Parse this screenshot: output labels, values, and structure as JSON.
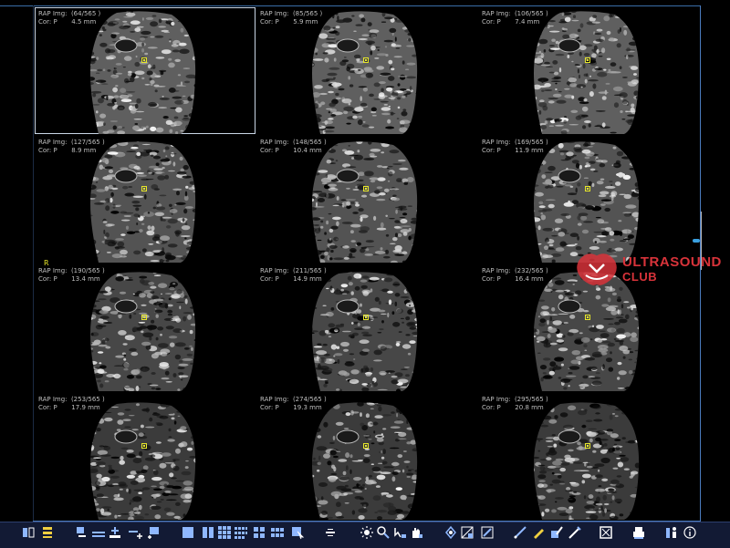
{
  "viewer": {
    "tiles": [
      {
        "title": "RAP Img:  (64/565 )",
        "cor": "Cor: P",
        "depth": "4.5 mm",
        "selected": true
      },
      {
        "title": "RAP Img:  (85/565 )",
        "cor": "Cor: P",
        "depth": "5.9 mm",
        "selected": false
      },
      {
        "title": "RAP Img:  (106/565 )",
        "cor": "Cor: P",
        "depth": "7.4 mm",
        "selected": false
      },
      {
        "title": "RAP Img:  (127/565 )",
        "cor": "Cor: P",
        "depth": "8.9 mm",
        "selected": false
      },
      {
        "title": "RAP Img:  (148/565 )",
        "cor": "Cor: P",
        "depth": "10.4 mm",
        "selected": false
      },
      {
        "title": "RAP Img:  (169/565 )",
        "cor": "Cor: P",
        "depth": "11.9 mm",
        "selected": false
      },
      {
        "title": "RAP Img:  (190/565 )",
        "cor": "Cor: P",
        "depth": "13.4 mm",
        "selected": false
      },
      {
        "title": "RAP Img:  (211/565 )",
        "cor": "Cor: P",
        "depth": "14.9 mm",
        "selected": false
      },
      {
        "title": "RAP Img:  (232/565 )",
        "cor": "Cor: P",
        "depth": "16.4 mm",
        "selected": false
      },
      {
        "title": "RAP Img:  (253/565 )",
        "cor": "Cor: P",
        "depth": "17.9 mm",
        "selected": false
      },
      {
        "title": "RAP Img:  (274/565 )",
        "cor": "Cor: P",
        "depth": "19.3 mm",
        "selected": false
      },
      {
        "title": "RAP Img:  (295/565 )",
        "cor": "Cor: P",
        "depth": "20.8 mm",
        "selected": false
      }
    ],
    "orientation_label": "R"
  },
  "watermark": {
    "line1": "ULTRASOUND",
    "line2": "CLUB",
    "color": "#d8333a"
  },
  "colors": {
    "marker": "#e6e62a",
    "toolbar_bg": "#121a34",
    "frame": "#4b7cc0"
  },
  "toolbar": {
    "buttons": [
      {
        "icon": "layout-toggle-icon"
      },
      {
        "icon": "list-icon"
      },
      {
        "icon": "slice-minus-icon"
      },
      {
        "icon": "slice-spacing-icon"
      },
      {
        "icon": "slice-plus-icon"
      },
      {
        "icon": "spacing-plus-icon"
      },
      {
        "icon": "slice-add-icon"
      },
      {
        "icon": "layout-1x1-icon"
      },
      {
        "icon": "layout-2x1-icon"
      },
      {
        "icon": "layout-3x3-icon"
      },
      {
        "icon": "layout-4x3-icon"
      },
      {
        "icon": "layout-2x2-icon"
      },
      {
        "icon": "layout-3x2-icon"
      },
      {
        "icon": "cursor-icon"
      },
      {
        "icon": "center-align-icon"
      },
      {
        "icon": "brightness-icon"
      },
      {
        "icon": "magnify-icon"
      },
      {
        "icon": "zoom-pointer-icon"
      },
      {
        "icon": "pan-hand-icon"
      },
      {
        "icon": "rotate-icon"
      },
      {
        "icon": "crop-icon"
      },
      {
        "icon": "reset-view-icon"
      },
      {
        "icon": "measure-line-icon"
      },
      {
        "icon": "pencil-icon"
      },
      {
        "icon": "annotate-icon"
      },
      {
        "icon": "ruler-icon"
      },
      {
        "icon": "capture-icon"
      },
      {
        "icon": "print-icon"
      },
      {
        "icon": "figure-icon"
      },
      {
        "icon": "info-icon"
      }
    ]
  }
}
